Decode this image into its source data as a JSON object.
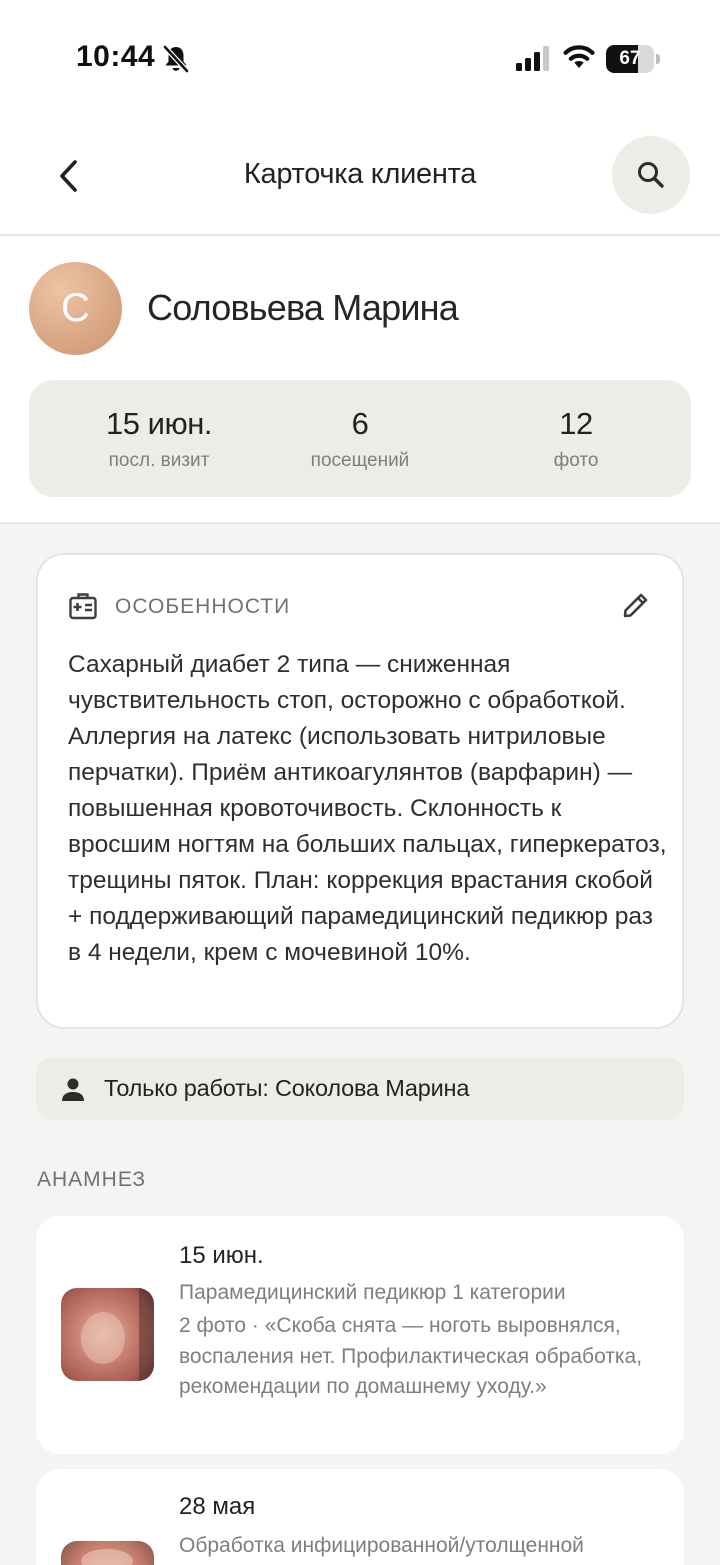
{
  "status_bar": {
    "time": "10:44",
    "battery": "67",
    "battery_level": 0.67,
    "icons": [
      "bell-slash-icon",
      "cellular-signal-icon",
      "wifi-icon",
      "battery-icon"
    ]
  },
  "nav": {
    "title": "Карточка клиента",
    "back_icon": "chevron-left-icon",
    "search_icon": "search-icon"
  },
  "client": {
    "initial": "С",
    "name": "Соловьева Марина"
  },
  "stats": [
    {
      "value": "15 июн.",
      "label": "посл. визит"
    },
    {
      "value": "6",
      "label": "посещений"
    },
    {
      "value": "12",
      "label": "фото"
    }
  ],
  "features": {
    "icon": "medical-card-icon",
    "title": "ОСОБЕННОСТИ",
    "edit_icon": "pencil-icon",
    "text": "Сахарный диабет 2 типа — сниженная чувствительность стоп, осторожно с обработкой. Аллергия на латекс (использовать нитриловые перчатки). Приём антикоагулянтов (варфарин) — повышенная кровоточивость. Склонность к вросшим ногтям на больших пальцах, гиперкератоз, трещины пяток. План: коррекция врастания скобой + поддерживающий парамедицинский педикюр раз в 4 недели, крем с мочевиной 10%."
  },
  "owner": {
    "icon": "person-icon",
    "text": "Только работы: Соколова Марина"
  },
  "anamnesis": {
    "title": "АНАМНЕЗ",
    "visits": [
      {
        "date": "15 июн.",
        "service": "Парамедицинский педикюр 1 категории",
        "note": "2 фото · «Скоба снята — ноготь выровнялся, воспаления нет. Профилактическая обработка, рекомендации по домашнему уходу.»"
      },
      {
        "date": "28 мая",
        "service": "Обработка инфицированной/утолщенной",
        "note": ""
      }
    ]
  },
  "colors": {
    "background": "#f4f5f3",
    "surface": "#ffffff",
    "chip": "#edece7",
    "avatar": "#d9a683",
    "muted_text": "#7d807c"
  }
}
